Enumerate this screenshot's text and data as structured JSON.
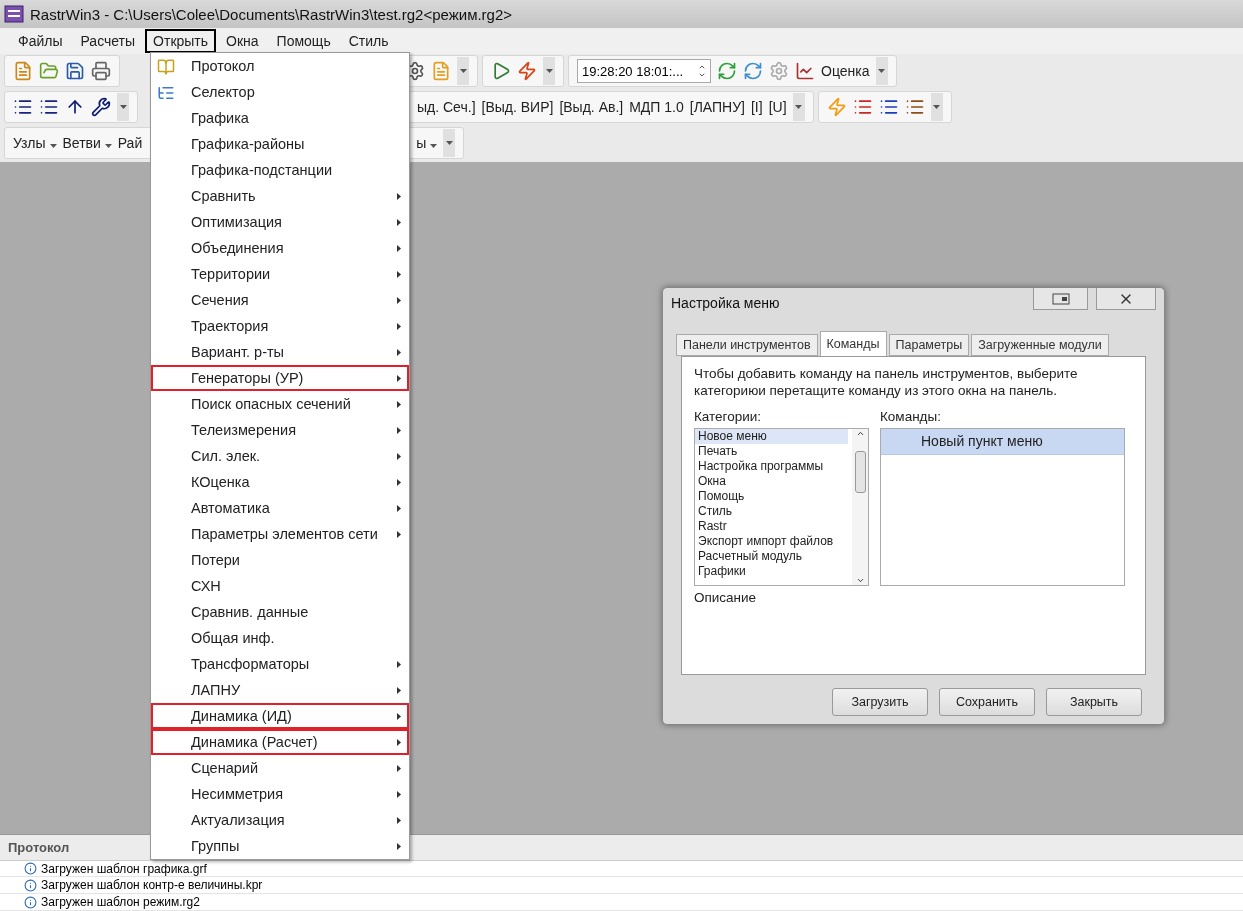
{
  "window": {
    "title": "RastrWin3 - C:\\Users\\Colee\\Documents\\RastrWin3\\test.rg2<режим.rg2>"
  },
  "menu_bar": [
    {
      "label": "Файлы",
      "selected": false
    },
    {
      "label": "Расчеты",
      "selected": false
    },
    {
      "label": "Открыть",
      "selected": true
    },
    {
      "label": "Окна",
      "selected": false
    },
    {
      "label": "Помощь",
      "selected": false
    },
    {
      "label": "Стиль",
      "selected": false
    }
  ],
  "toolbar_1": {
    "time_field": {
      "value": "19:28:20  18:01:..."
    },
    "button": "Оценка"
  },
  "toolbar_2": {
    "items": [
      "ыд. Сеч.]",
      "[Выд. ВИР]",
      "[Выд. Ав.]",
      "МДП 1.0",
      "[ЛАПНУ]",
      "[I]",
      "[U]"
    ]
  },
  "toolbar_3": {
    "items": [
      {
        "label": "Узлы",
        "dropdown": true
      },
      {
        "label": "Ветви",
        "dropdown": true
      },
      {
        "label": "Рай",
        "dropdown": false
      },
      {
        "label": "ы",
        "dropdown": true
      }
    ]
  },
  "open_menu": {
    "items": [
      {
        "label": "Протокол",
        "submenu": false,
        "outlined": false
      },
      {
        "label": "Селектор",
        "submenu": false,
        "outlined": false
      },
      {
        "label": "Графика",
        "submenu": false,
        "outlined": false
      },
      {
        "label": "Графика-районы",
        "submenu": false,
        "outlined": false
      },
      {
        "label": "Графика-подстанции",
        "submenu": false,
        "outlined": false
      },
      {
        "label": "Сравнить",
        "submenu": true,
        "outlined": false
      },
      {
        "label": "Оптимизация",
        "submenu": true,
        "outlined": false
      },
      {
        "label": "Объединения",
        "submenu": true,
        "outlined": false
      },
      {
        "label": "Территории",
        "submenu": true,
        "outlined": false
      },
      {
        "label": "Сечения",
        "submenu": true,
        "outlined": false
      },
      {
        "label": "Траектория",
        "submenu": true,
        "outlined": false
      },
      {
        "label": "Вариант. р-ты",
        "submenu": true,
        "outlined": false
      },
      {
        "label": "Генераторы (УР)",
        "submenu": true,
        "outlined": true
      },
      {
        "label": "Поиск опасных сечений",
        "submenu": true,
        "outlined": false
      },
      {
        "label": "Телеизмерения",
        "submenu": true,
        "outlined": false
      },
      {
        "label": "Сил. элек.",
        "submenu": true,
        "outlined": false
      },
      {
        "label": "КОценка",
        "submenu": true,
        "outlined": false
      },
      {
        "label": "Автоматика",
        "submenu": true,
        "outlined": false
      },
      {
        "label": "Параметры элементов сети",
        "submenu": true,
        "outlined": false
      },
      {
        "label": "Потери",
        "submenu": false,
        "outlined": false
      },
      {
        "label": "СХН",
        "submenu": false,
        "outlined": false
      },
      {
        "label": "Сравнив. данные",
        "submenu": false,
        "outlined": false
      },
      {
        "label": "Общая инф.",
        "submenu": false,
        "outlined": false
      },
      {
        "label": "Трансформаторы",
        "submenu": true,
        "outlined": false
      },
      {
        "label": "ЛАПНУ",
        "submenu": true,
        "outlined": false
      },
      {
        "label": "Динамика (ИД)",
        "submenu": true,
        "outlined": true
      },
      {
        "label": "Динамика (Расчет)",
        "submenu": true,
        "outlined": true
      },
      {
        "label": "Сценарий",
        "submenu": true,
        "outlined": false
      },
      {
        "label": "Несимметрия",
        "submenu": true,
        "outlined": false
      },
      {
        "label": "Актуализация",
        "submenu": true,
        "outlined": false
      },
      {
        "label": "Группы",
        "submenu": true,
        "outlined": false
      }
    ]
  },
  "dialog": {
    "title": "Настройка меню",
    "tabs": [
      {
        "label": "Панели инструментов",
        "selected": false
      },
      {
        "label": "Команды",
        "selected": true
      },
      {
        "label": "Параметры",
        "selected": false
      },
      {
        "label": "Загруженные модули",
        "selected": false
      }
    ],
    "instruction": "Чтобы добавить команду на панель инструментов, выберите категориюи перетащите команду из этого окна на панель.",
    "categories_label": "Категории:",
    "categories": [
      {
        "label": "Новое меню",
        "selected": true
      },
      {
        "label": "Печать",
        "selected": false
      },
      {
        "label": "Настройка программы",
        "selected": false
      },
      {
        "label": "Окна",
        "selected": false
      },
      {
        "label": "Помощь",
        "selected": false
      },
      {
        "label": "Стиль",
        "selected": false
      },
      {
        "label": "Rastr",
        "selected": false
      },
      {
        "label": "Экспорт импорт файлов",
        "selected": false
      },
      {
        "label": "Расчетный модуль",
        "selected": false
      },
      {
        "label": "Графики",
        "selected": false
      }
    ],
    "commands_label": "Команды:",
    "commands": [
      {
        "label": "Новый пункт меню",
        "selected": true
      }
    ],
    "description_label": "Описание",
    "buttons": [
      "Загрузить",
      "Сохранить",
      "Закрыть"
    ]
  },
  "protocol": {
    "title": "Протокол",
    "rows": [
      "Загружен шаблон графика.grf",
      "Загружен шаблон контр-е величины.kpr",
      "Загружен шаблон режим.rg2"
    ]
  }
}
